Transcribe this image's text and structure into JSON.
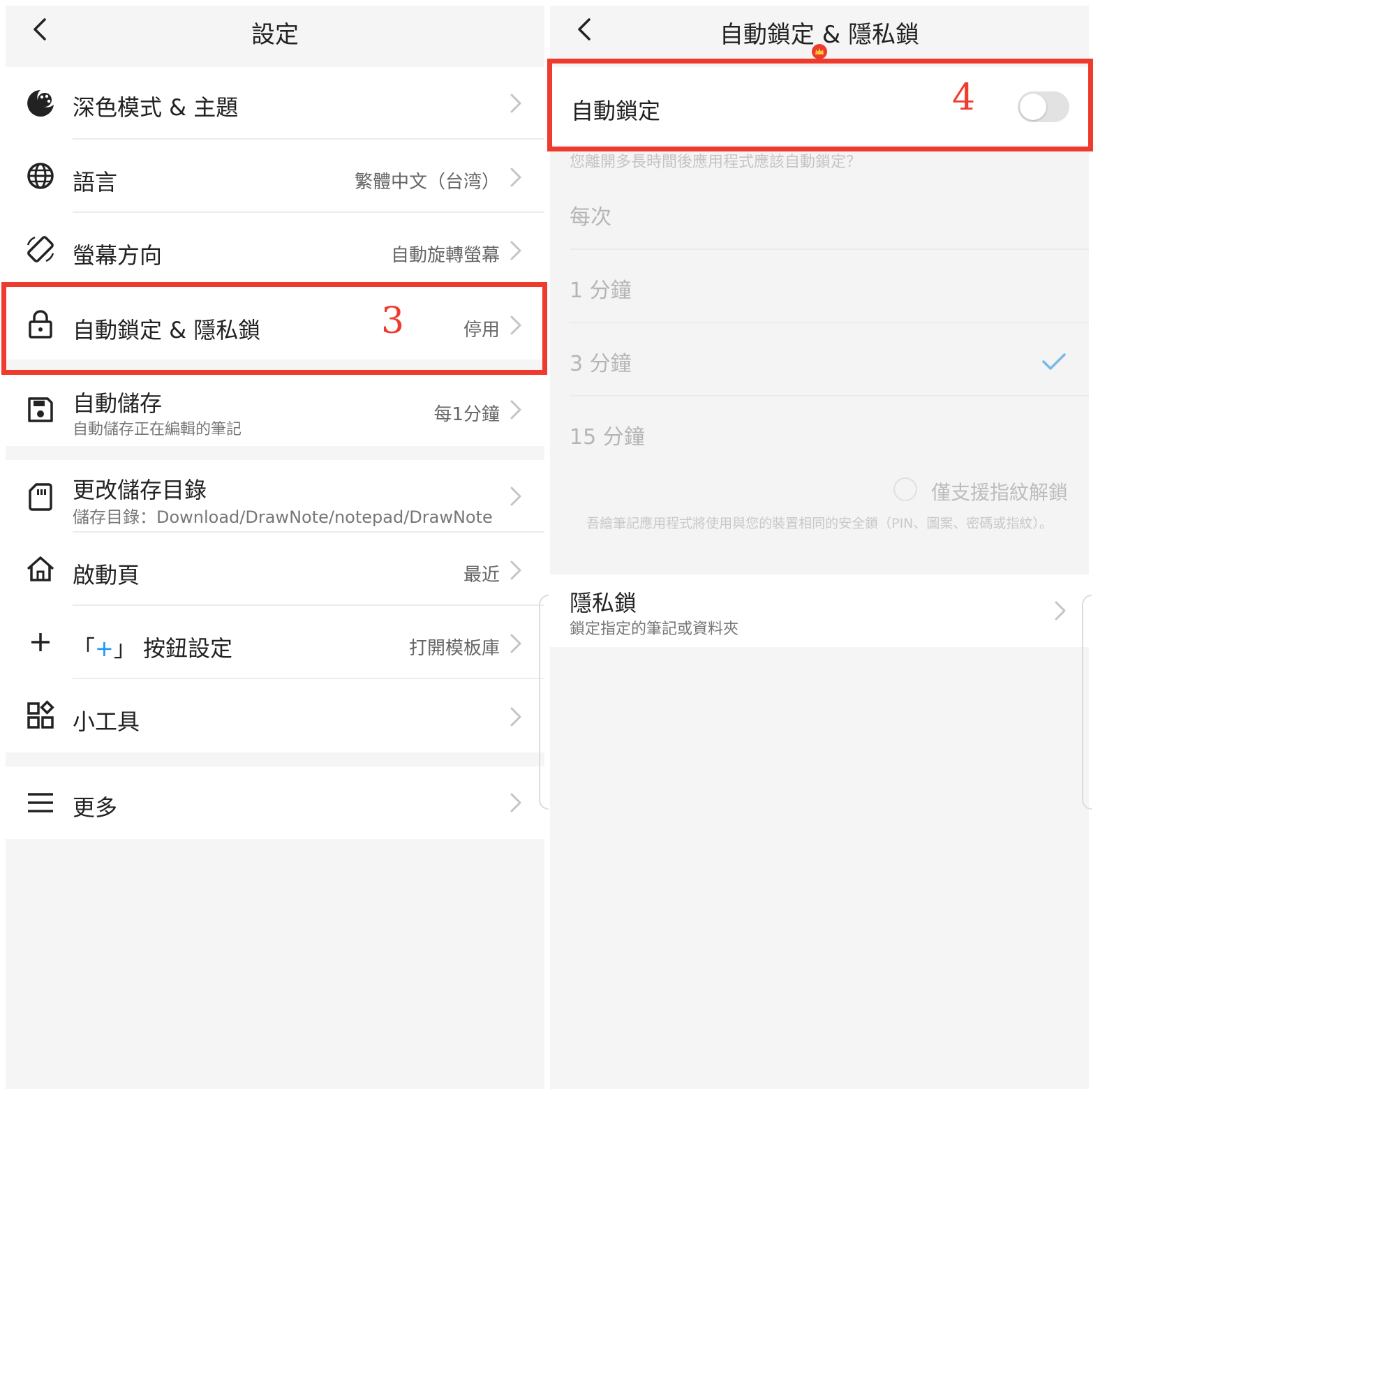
{
  "settings": {
    "title": "設定",
    "items": [
      {
        "label": "深色模式 & 主題",
        "icon": "palette-icon"
      },
      {
        "label": "語言",
        "value": "繁體中文（台湾）",
        "icon": "globe-icon"
      },
      {
        "label": "螢幕方向",
        "value": "自動旋轉螢幕",
        "icon": "screen-rotation-icon"
      },
      {
        "label": "自動鎖定 & 隱私鎖",
        "value": "停用",
        "icon": "lock-icon"
      },
      {
        "label": "自動儲存",
        "sub": "自動儲存正在編輯的筆記",
        "value": "每1分鐘",
        "icon": "save-icon"
      },
      {
        "label": "更改儲存目錄",
        "sub": "儲存目錄：Download/DrawNote/notepad/DrawNote",
        "icon": "sd-card-icon"
      },
      {
        "label": "啟動頁",
        "value": "最近",
        "icon": "home-icon"
      },
      {
        "label_open": "「",
        "label_plus": "+",
        "label_close": "」 按鈕設定",
        "value": "打開模板庫",
        "icon": "plus-icon"
      },
      {
        "label": "小工具",
        "icon": "widgets-icon"
      },
      {
        "label": "更多",
        "icon": "menu-icon"
      }
    ]
  },
  "autolock": {
    "title": "自動鎖定 & 隱私鎖",
    "toggle_label": "自動鎖定",
    "toggle_on": false,
    "question": "您離開多長時間後應用程式應該自動鎖定？",
    "options": [
      {
        "label": "每次",
        "selected": false
      },
      {
        "label": "1 分鐘",
        "selected": false
      },
      {
        "label": "3 分鐘",
        "selected": true
      },
      {
        "label": "15 分鐘",
        "selected": false
      }
    ],
    "fingerprint_label": "僅支援指紋解鎖",
    "note": "吾繪筆記應用程式將使用與您的裝置相同的安全鎖（PIN、圖案、密碼或指紋）。",
    "privacy": {
      "label": "隱私鎖",
      "sub": "鎖定指定的筆記或資料夾"
    }
  },
  "annotations": {
    "step3": "3",
    "step4": "4"
  },
  "colors": {
    "highlight": "#ef3b2d",
    "accent": "#2196f3",
    "check": "#7ab8e8"
  }
}
